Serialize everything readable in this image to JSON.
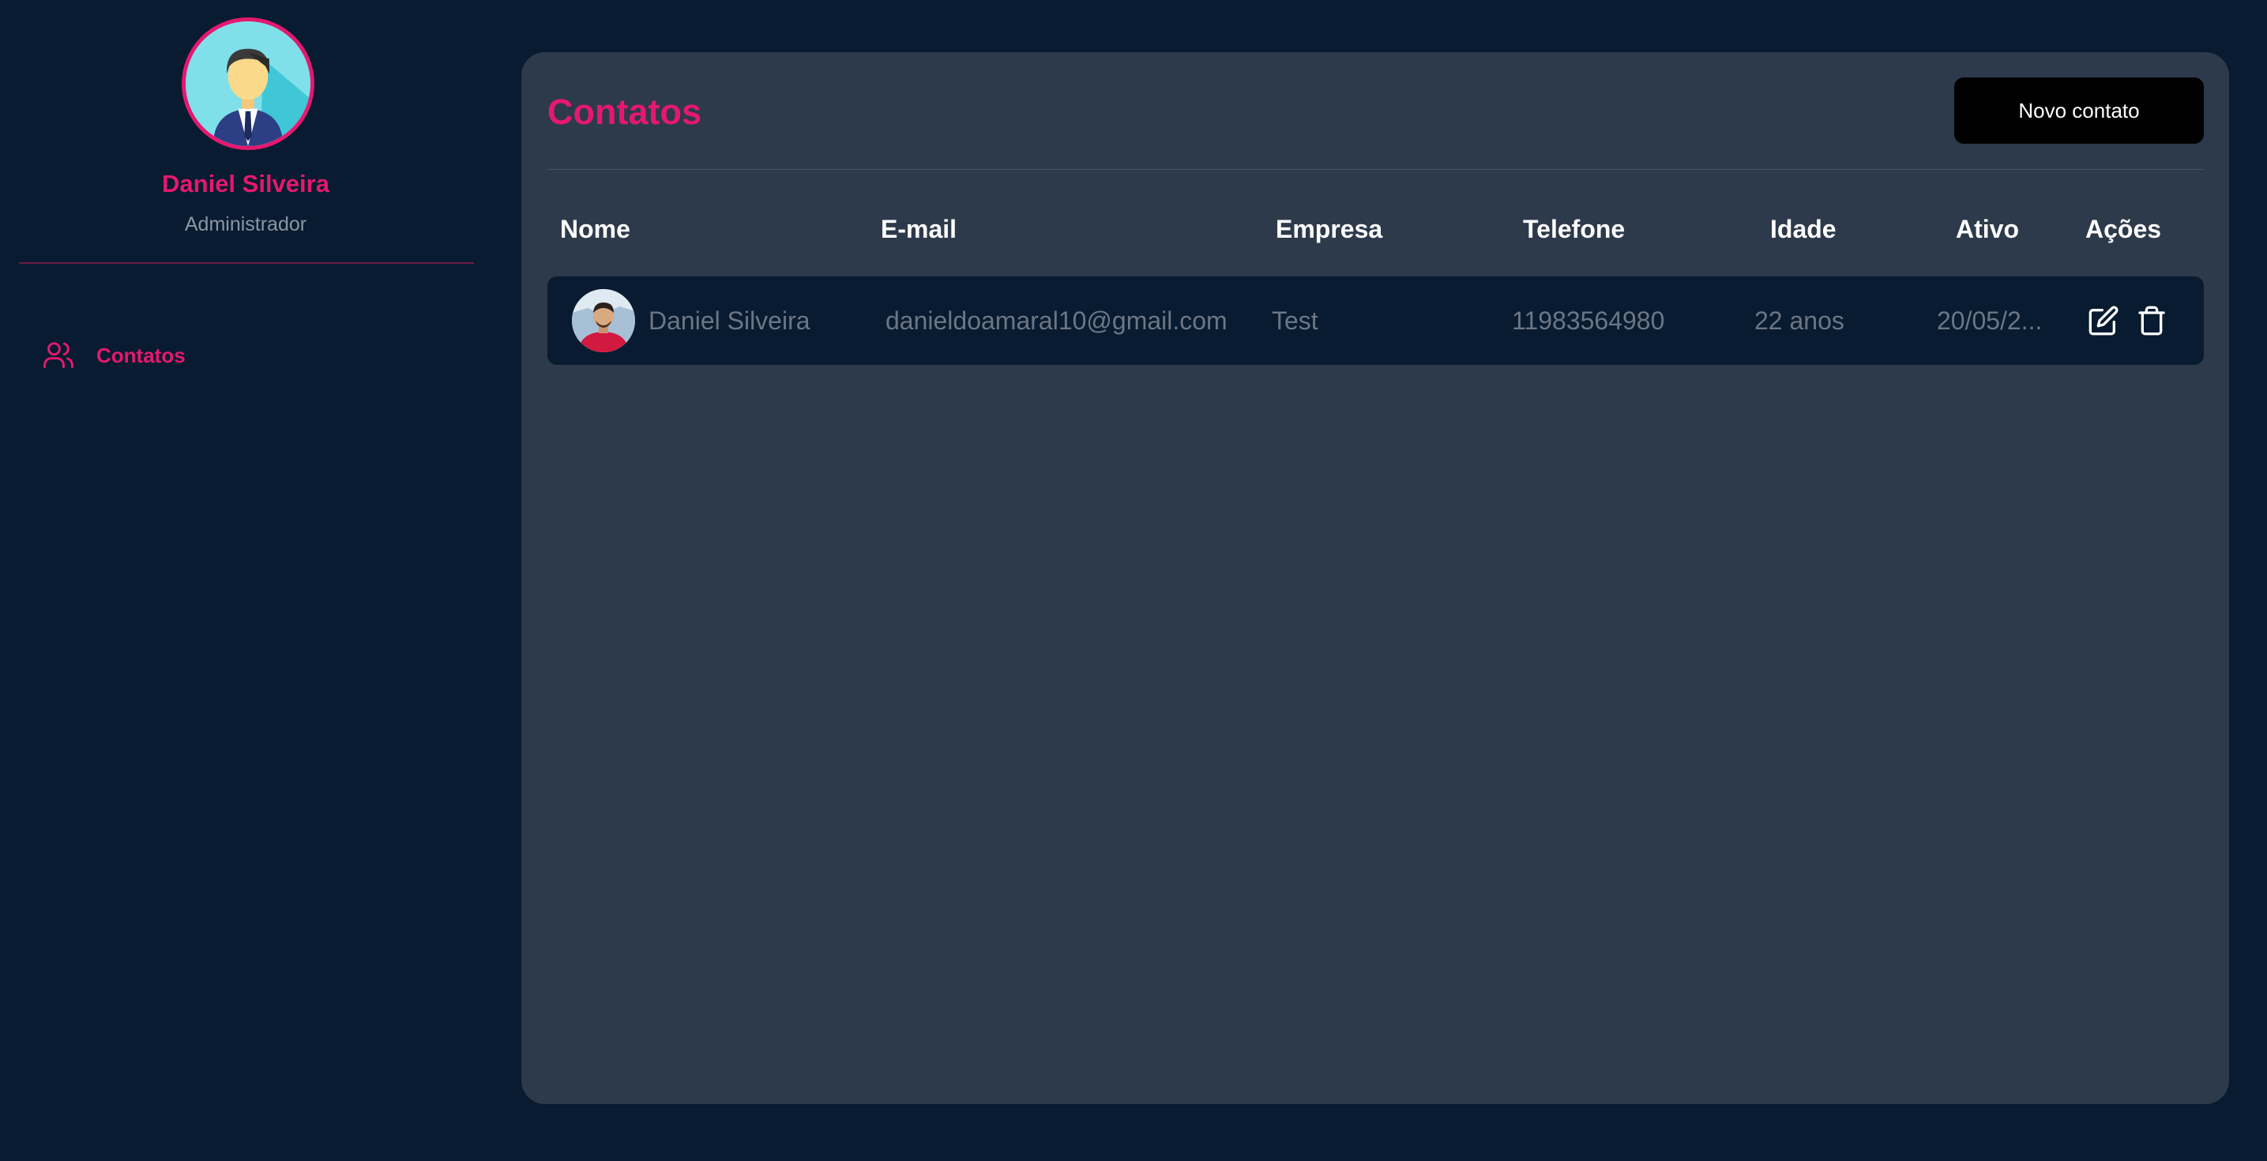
{
  "user": {
    "name": "Daniel Silveira",
    "role": "Administrador"
  },
  "sidebar": {
    "items": [
      {
        "label": "Contatos",
        "icon": "users-icon",
        "active": true
      }
    ]
  },
  "main": {
    "title": "Contatos",
    "new_button_label": "Novo contato",
    "table": {
      "headers": [
        "Nome",
        "E-mail",
        "Empresa",
        "Telefone",
        "Idade",
        "Ativo",
        "Ações"
      ],
      "rows": [
        {
          "name": "Daniel Silveira",
          "email": "danieldoamaral10@gmail.com",
          "company": "Test",
          "phone": "11983564980",
          "age": "22 anos",
          "active": "20/05/2..."
        }
      ]
    }
  },
  "colors": {
    "background": "#081b30",
    "panel": "#2d3a4b",
    "accent": "#e5186f",
    "muted_text": "#6c7685"
  }
}
